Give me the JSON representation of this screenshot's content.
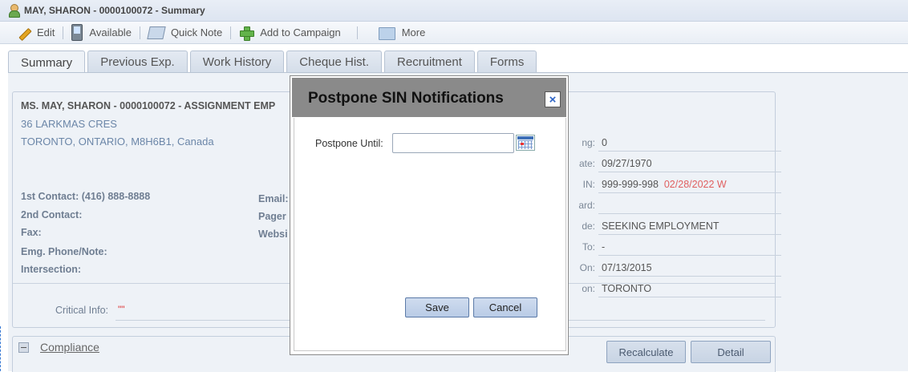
{
  "window": {
    "title": "MAY, SHARON - 0000100072 - Summary"
  },
  "toolbar": {
    "edit": "Edit",
    "available": "Available",
    "quick_note": "Quick Note",
    "add_to_campaign": "Add to Campaign",
    "more": "More"
  },
  "tabs": [
    {
      "label": "Summary",
      "active": true
    },
    {
      "label": "Previous Exp."
    },
    {
      "label": "Work History"
    },
    {
      "label": "Cheque Hist."
    },
    {
      "label": "Recruitment"
    },
    {
      "label": "Forms"
    }
  ],
  "profile": {
    "name_line": "MS. MAY, SHARON - 0000100072 - ASSIGNMENT EMP",
    "address1": "36 LARKMAS CRES",
    "address2": "TORONTO, ONTARIO, M8H6B1, Canada",
    "contact1": "1st Contact: (416) 888-8888",
    "contact2": "2nd Contact:",
    "fax": "Fax:",
    "emg": "Emg. Phone/Note:",
    "intersection": "Intersection:",
    "email": "Email:",
    "pager": "Pager",
    "website": "Websi",
    "critical_label": "Critical Info:",
    "critical_value": "\"\""
  },
  "right_fields": [
    {
      "label": "ng:",
      "value": "0"
    },
    {
      "label": "ate:",
      "value": "09/27/1970"
    },
    {
      "label": "IN:",
      "value": "999-999-998",
      "extra": "02/28/2022 W"
    },
    {
      "label": "ard:",
      "value": ""
    },
    {
      "label": "de:",
      "value": "SEEKING EMPLOYMENT"
    },
    {
      "label": "To:",
      "value": "-"
    },
    {
      "label": "On:",
      "value": "07/13/2015"
    },
    {
      "label": "on:",
      "value": "TORONTO"
    }
  ],
  "compliance": {
    "title": "Compliance",
    "recalculate": "Recalculate",
    "detail": "Detail"
  },
  "dialog": {
    "title": "Postpone SIN Notifications",
    "close": "×",
    "postpone_label": "Postpone Until:",
    "postpone_value": "",
    "save": "Save",
    "cancel": "Cancel"
  },
  "colors": {
    "accent": "#2c63c5",
    "warning": "#e06060",
    "tab_bg": "#d4dde9"
  }
}
